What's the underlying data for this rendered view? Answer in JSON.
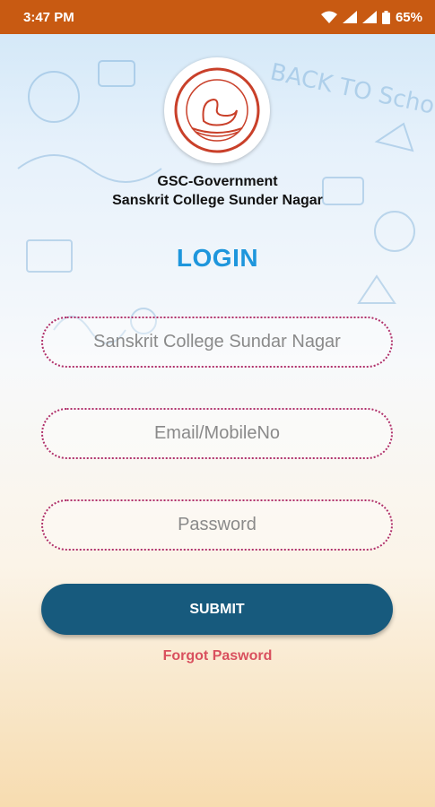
{
  "status_bar": {
    "time": "3:47 PM",
    "battery": "65%",
    "icons": [
      "wifi-icon",
      "signal-icon",
      "battery-icon"
    ]
  },
  "background_doodle_text": "BACK TO School",
  "college": {
    "name_line1": "GSC-Government",
    "name_line2": "Sanskrit College Sunder Nagar"
  },
  "login": {
    "title": "LOGIN",
    "college_field_placeholder": "Sanskrit College Sundar Nagar",
    "email_placeholder": "Email/MobileNo",
    "password_placeholder": "Password",
    "submit_label": "SUBMIT",
    "forgot_label": "Forgot Pasword"
  },
  "colors": {
    "status_bar": "#c85a12",
    "title": "#1e96dc",
    "button": "#175a7d",
    "field_border": "#b0306a",
    "forgot": "#d9505e"
  }
}
